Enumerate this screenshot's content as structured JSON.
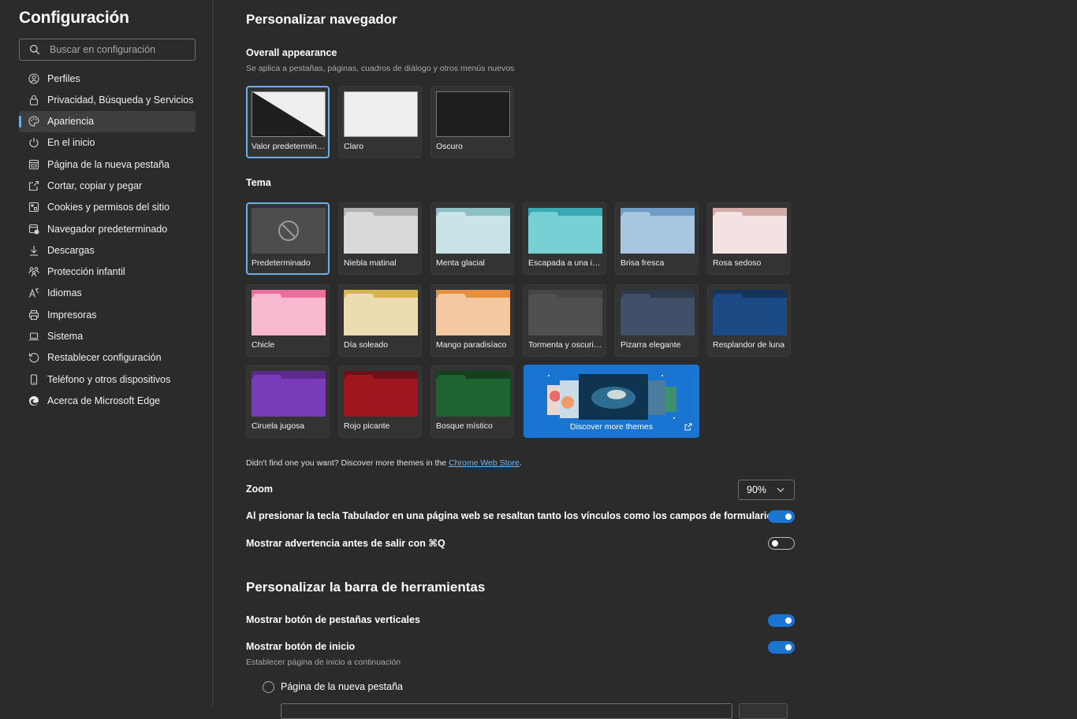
{
  "sidebar": {
    "title": "Configuración",
    "search_placeholder": "Buscar en configuración",
    "items": [
      {
        "label": "Perfiles",
        "icon": "profile-icon"
      },
      {
        "label": "Privacidad, Búsqueda y Servicios",
        "icon": "lock-icon"
      },
      {
        "label": "Apariencia",
        "icon": "palette-icon",
        "active": true
      },
      {
        "label": "En el inicio",
        "icon": "power-icon"
      },
      {
        "label": "Página de la nueva pestaña",
        "icon": "new-tab-icon"
      },
      {
        "label": "Cortar, copiar y pegar",
        "icon": "share-icon"
      },
      {
        "label": "Cookies y permisos del sitio",
        "icon": "cookie-icon"
      },
      {
        "label": "Navegador predeterminado",
        "icon": "default-browser-icon"
      },
      {
        "label": "Descargas",
        "icon": "download-icon"
      },
      {
        "label": "Protección infantil",
        "icon": "family-icon"
      },
      {
        "label": "Idiomas",
        "icon": "language-icon"
      },
      {
        "label": "Impresoras",
        "icon": "printer-icon"
      },
      {
        "label": "Sistema",
        "icon": "laptop-icon"
      },
      {
        "label": "Restablecer configuración",
        "icon": "reset-icon"
      },
      {
        "label": "Teléfono y otros dispositivos",
        "icon": "phone-icon"
      },
      {
        "label": "Acerca de Microsoft Edge",
        "icon": "edge-icon"
      }
    ]
  },
  "main": {
    "title": "Personalizar navegador",
    "appearance": {
      "title": "Overall appearance",
      "subtitle": "Se aplica a pestañas, páginas, cuadros de diálogo y otros menús nuevos",
      "options": [
        {
          "label": "Valor predeterminado",
          "selected": true
        },
        {
          "label": "Claro",
          "selected": false
        },
        {
          "label": "Oscuro",
          "selected": false
        }
      ]
    },
    "theme": {
      "title": "Tema",
      "options": [
        {
          "label": "Predeterminado",
          "selected": true
        },
        {
          "label": "Niebla matinal",
          "tab": "#b0b0b0",
          "body": "#d9d9d9"
        },
        {
          "label": "Menta glacial",
          "tab": "#8cc0c7",
          "body": "#c9e4e8"
        },
        {
          "label": "Escapada a una isla",
          "tab": "#3aa9b3",
          "body": "#76d0d4"
        },
        {
          "label": "Brisa fresca",
          "tab": "#6f9cc6",
          "body": "#a8c6e0"
        },
        {
          "label": "Rosa sedoso",
          "tab": "#d4aaa6",
          "body": "#f3e2e2"
        },
        {
          "label": "Chicle",
          "tab": "#ec6e9c",
          "body": "#f8b9d0"
        },
        {
          "label": "Día soleado",
          "tab": "#d8b44f",
          "body": "#eddcb2"
        },
        {
          "label": "Mango paradisíaco",
          "tab": "#e88f3e",
          "body": "#f4c8a0"
        },
        {
          "label": "Tormenta y oscuridad",
          "tab": "#454545",
          "body": "#505050"
        },
        {
          "label": "Pizarra elegante",
          "tab": "#2c3a4b",
          "body": "#3f5068"
        },
        {
          "label": "Resplandor de luna",
          "tab": "#15345b",
          "body": "#1c4a84"
        },
        {
          "label": "Ciruela jugosa",
          "tab": "#5a2a8c",
          "body": "#7a3bb8"
        },
        {
          "label": "Rojo picante",
          "tab": "#6e1018",
          "body": "#a0161f"
        },
        {
          "label": "Bosque místico",
          "tab": "#14401e",
          "body": "#1d6430"
        }
      ],
      "discover_label": "Discover more themes",
      "hint_prefix": "Didn't find one you want? Discover more themes in the ",
      "hint_link": "Chrome Web Store",
      "hint_suffix": "."
    },
    "zoom": {
      "label": "Zoom",
      "value": "90%"
    },
    "tab_highlight": {
      "label": "Al presionar la tecla Tabulador en una página web se resaltan tanto los vínculos como los campos de formularios.",
      "on": true
    },
    "quit_warning": {
      "label": "Mostrar advertencia antes de salir con ⌘Q",
      "on": false
    },
    "toolbar": {
      "title": "Personalizar la barra de herramientas",
      "vertical_tabs": {
        "label": "Mostrar botón de pestañas verticales",
        "on": true
      },
      "home_button": {
        "label": "Mostrar botón de inicio",
        "sub": "Establecer página de inicio a continuación",
        "on": true
      },
      "home_option_new_tab": "Página de la nueva pestaña"
    }
  }
}
